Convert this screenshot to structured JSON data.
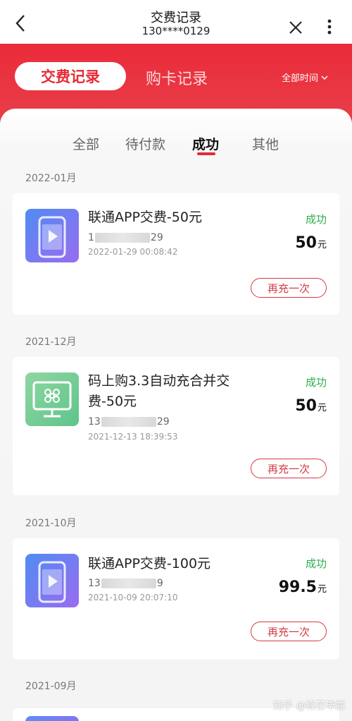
{
  "titlebar": {
    "title": "交费记录",
    "subtitle": "130****0129",
    "back_icon": "chevron-left-icon",
    "close_icon": "close-icon",
    "more_icon": "more-vertical-icon"
  },
  "main_tabs": [
    {
      "label": "交费记录",
      "active": true
    },
    {
      "label": "购卡记录",
      "active": false
    }
  ],
  "time_filter": {
    "label": "全部时间"
  },
  "sub_tabs": [
    {
      "label": "全部",
      "active": false
    },
    {
      "label": "待付款",
      "active": false
    },
    {
      "label": "成功",
      "active": true
    },
    {
      "label": "其他",
      "active": false
    }
  ],
  "groups": [
    {
      "month": "2022-01月",
      "record": {
        "title": "联通APP交费-50元",
        "phone_prefix": "1",
        "phone_suffix": "29",
        "time": "2022-01-29 00:08:42",
        "status": "成功",
        "amount": "50",
        "unit": "元",
        "button": "再充一次",
        "icon": "phone-play-icon"
      }
    },
    {
      "month": "2021-12月",
      "record": {
        "title": "码上购3.3自动充合并交费-50元",
        "phone_prefix": "13",
        "phone_suffix": "29",
        "time": "2021-12-13 18:39:53",
        "status": "成功",
        "amount": "50",
        "unit": "元",
        "button": "再充一次",
        "icon": "unicom-monitor-icon"
      }
    },
    {
      "month": "2021-10月",
      "record": {
        "title": "联通APP交费-100元",
        "phone_prefix": "13",
        "phone_suffix": "9",
        "time": "2021-10-09 20:07:10",
        "status": "成功",
        "amount": "99.5",
        "unit": "元",
        "button": "再充一次",
        "icon": "phone-play-icon"
      }
    }
  ],
  "next_month": "2021-09月",
  "watermark": "知乎 @锋芒毕露",
  "colors": {
    "brand_red": "#e62a36",
    "success_green": "#2fae4f"
  }
}
